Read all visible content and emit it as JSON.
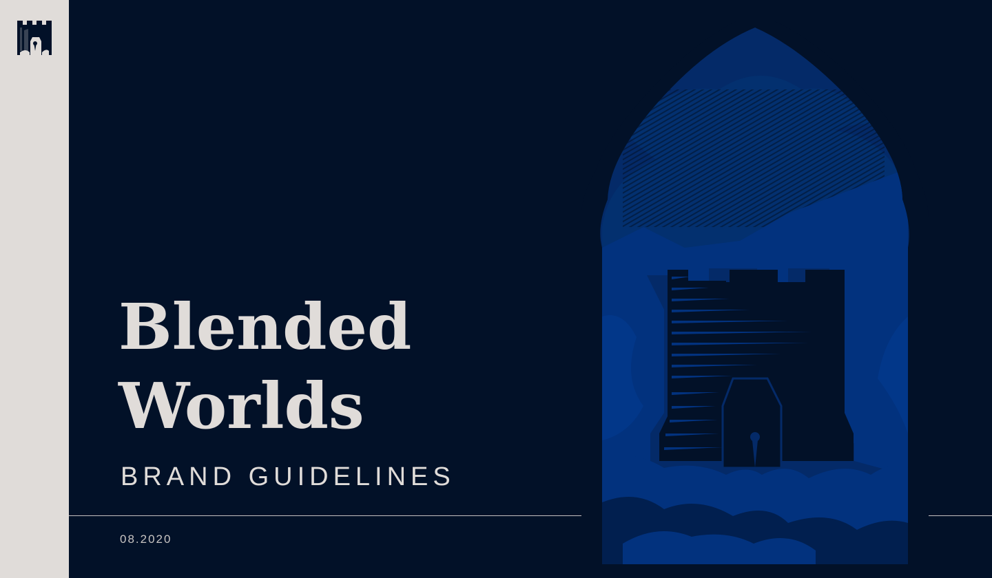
{
  "sidebar": {
    "logo_icon": "castle-tower-logo-icon"
  },
  "cover": {
    "title_line1": "Blended",
    "title_line2": "Worlds",
    "subtitle": "BRAND GUIDELINES",
    "date": "08.2020"
  },
  "illustration": {
    "icon": "castle-tower-arch-illustration"
  },
  "colors": {
    "background": "#021128",
    "sidebar": "#e0dcd9",
    "text": "#e0dcd9",
    "illustration_blue": "#02327e",
    "illustration_mid": "#042a68",
    "illustration_dark": "#021128"
  }
}
